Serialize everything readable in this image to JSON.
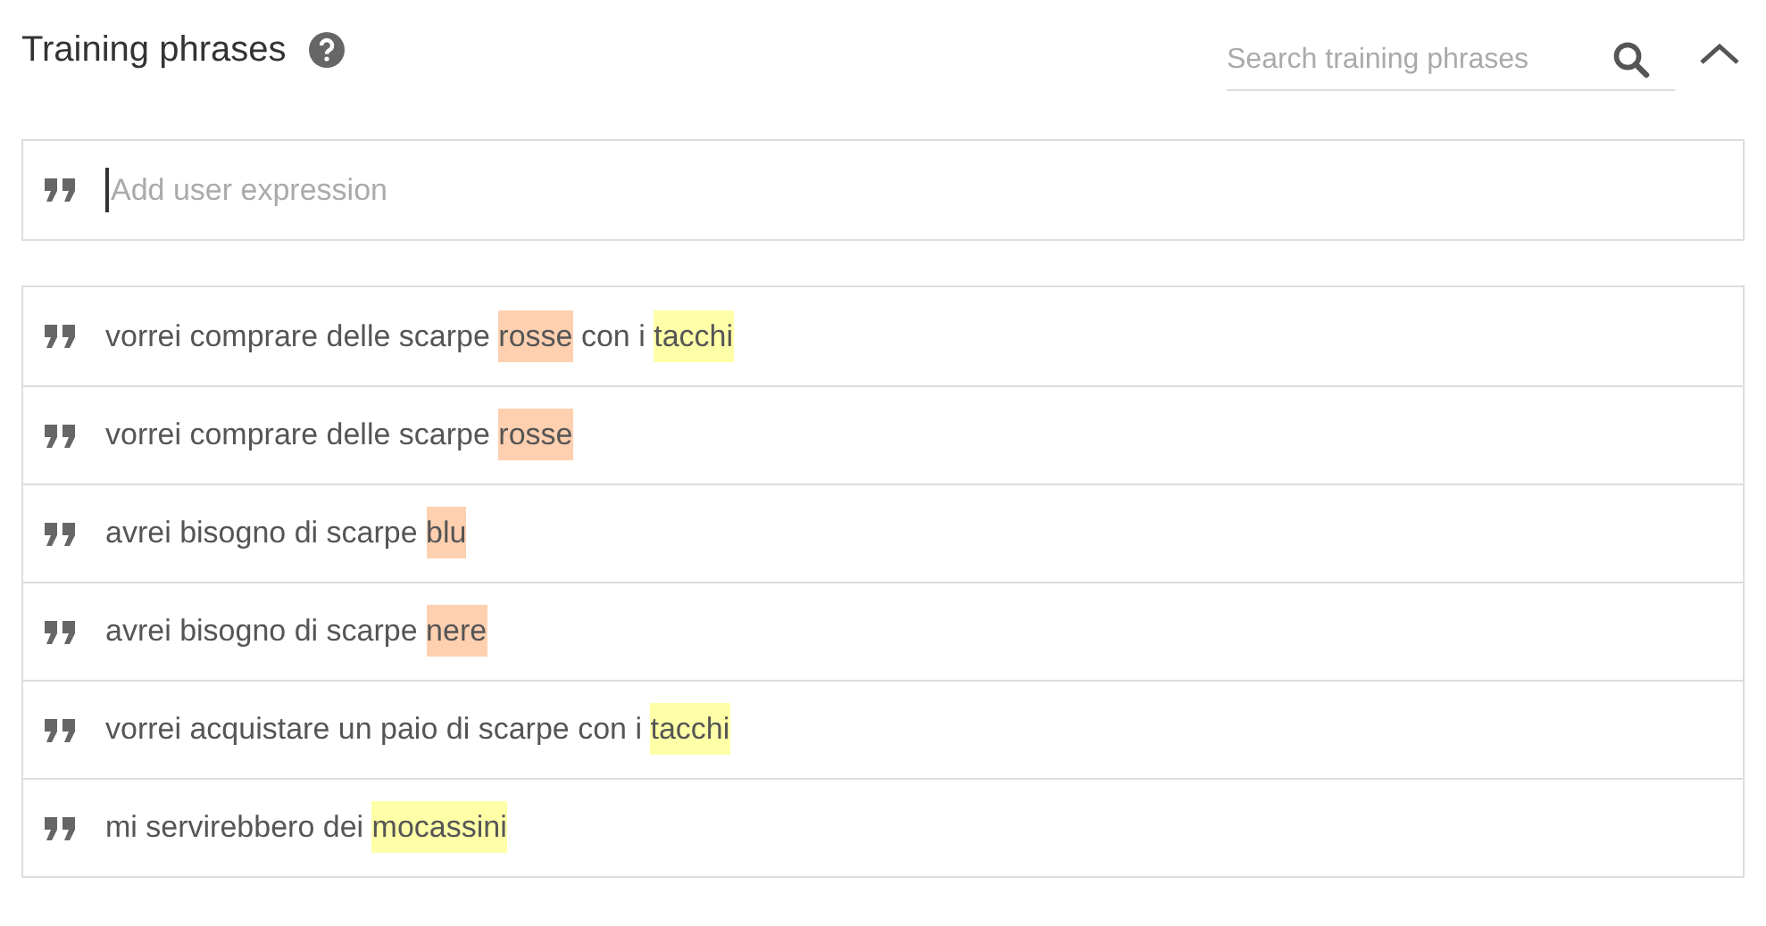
{
  "header": {
    "title": "Training phrases",
    "search": {
      "placeholder": "Search training phrases"
    }
  },
  "new_phrase": {
    "placeholder": "Add user expression"
  },
  "phrases": [
    {
      "segments": [
        {
          "text": "vorrei comprare delle scarpe "
        },
        {
          "text": "rosse",
          "color": "#ffd0b0"
        },
        {
          "text": " con i "
        },
        {
          "text": "tacchi",
          "color": "#ffffa8"
        }
      ]
    },
    {
      "segments": [
        {
          "text": "vorrei comprare delle scarpe "
        },
        {
          "text": "rosse",
          "color": "#ffd0b0"
        }
      ]
    },
    {
      "segments": [
        {
          "text": "avrei bisogno di scarpe "
        },
        {
          "text": "blu",
          "color": "#ffd0b0"
        }
      ]
    },
    {
      "segments": [
        {
          "text": "avrei bisogno di scarpe "
        },
        {
          "text": "nere",
          "color": "#ffd0b0"
        }
      ]
    },
    {
      "segments": [
        {
          "text": "vorrei acquistare un paio di scarpe con i "
        },
        {
          "text": "tacchi",
          "color": "#ffffa8"
        }
      ]
    },
    {
      "segments": [
        {
          "text": "mi servirebbero dei "
        },
        {
          "text": "mocassini",
          "color": "#ffffa8"
        }
      ]
    }
  ]
}
